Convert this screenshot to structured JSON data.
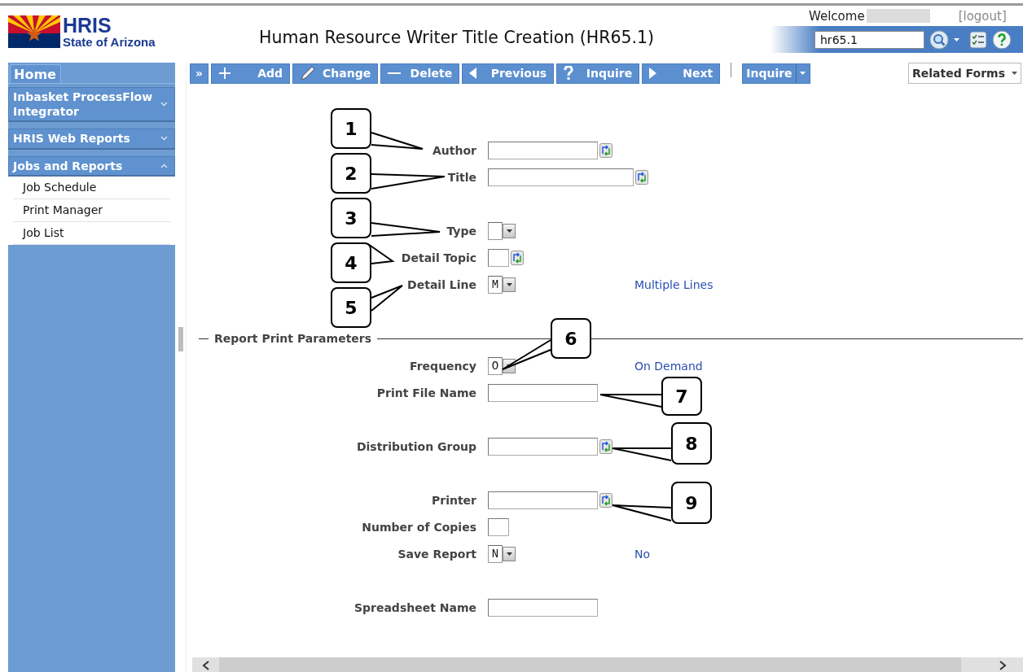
{
  "header": {
    "logo_title": "HRIS",
    "logo_subtitle": "State of Arizona",
    "title": "Human Resource Writer Title Creation (HR65.1)",
    "welcome": "Welcome",
    "logout": "[logout]",
    "search_value": "hr65.1"
  },
  "sidebar": {
    "home_tab": "Home",
    "sections": [
      {
        "label": "Inbasket ProcessFlow Integrator",
        "expanded": false
      },
      {
        "label": "HRIS Web Reports",
        "expanded": false
      },
      {
        "label": "Jobs and Reports",
        "expanded": true,
        "items": [
          "Job Schedule",
          "Print Manager",
          "Job List"
        ]
      }
    ]
  },
  "toolbar": {
    "buttons": [
      {
        "label": "»",
        "kind": "expand"
      },
      {
        "label": "Add",
        "kind": "add"
      },
      {
        "label": "Change",
        "kind": "change"
      },
      {
        "label": "Delete",
        "kind": "delete"
      },
      {
        "label": "Previous",
        "kind": "previous"
      },
      {
        "label": "Inquire",
        "kind": "inquire"
      },
      {
        "label": "Next",
        "kind": "next"
      }
    ],
    "menu_button": "Inquire",
    "related_forms": "Related Forms"
  },
  "form": {
    "fields": [
      {
        "label": "Author",
        "kind": "lookup"
      },
      {
        "label": "Title",
        "kind": "long-lookup"
      },
      {
        "label": "Type",
        "kind": "select"
      },
      {
        "label": "Detail Topic",
        "kind": "small-lookup"
      },
      {
        "label": "Detail Line",
        "kind": "select",
        "value": "M",
        "description": "Multiple Lines"
      }
    ],
    "section": {
      "title": "Report Print Parameters",
      "fields": [
        {
          "label": "Frequency",
          "kind": "select",
          "value": "O",
          "description": "On Demand"
        },
        {
          "label": "Print File Name",
          "kind": "text"
        },
        {
          "label": "Distribution Group",
          "kind": "lookup"
        },
        {
          "label": "Printer",
          "kind": "lookup"
        },
        {
          "label": "Number of Copies",
          "kind": "small-text"
        },
        {
          "label": "Save Report",
          "kind": "select",
          "value": "N",
          "description": "No"
        },
        {
          "label": "Spreadsheet Name",
          "kind": "text"
        }
      ]
    }
  },
  "callouts": [
    {
      "number": "1"
    },
    {
      "number": "2"
    },
    {
      "number": "3"
    },
    {
      "number": "4"
    },
    {
      "number": "5"
    },
    {
      "number": "6"
    },
    {
      "number": "7"
    },
    {
      "number": "8"
    },
    {
      "number": "9"
    }
  ]
}
